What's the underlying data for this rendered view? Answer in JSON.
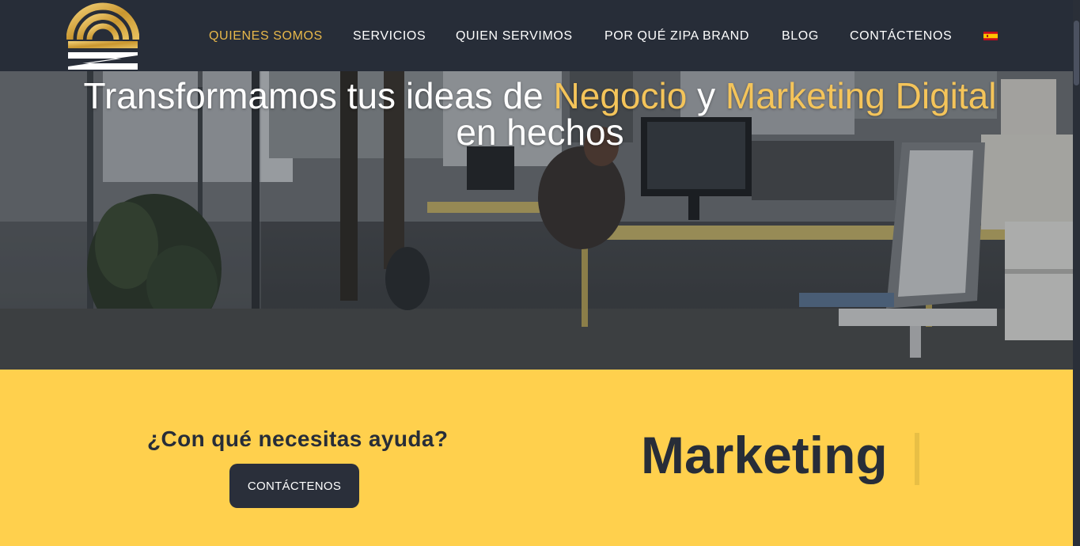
{
  "header": {
    "nav": [
      {
        "label": "QUIENES SOMOS",
        "active": true
      },
      {
        "label": "SERVICIOS",
        "active": false
      },
      {
        "label": "QUIEN SERVIMOS",
        "active": false
      },
      {
        "label": "POR QUÉ ZIPA BRAND",
        "active": false
      },
      {
        "label": "BLOG",
        "active": false
      },
      {
        "label": "CONTÁCTENOS",
        "active": false
      }
    ],
    "language_icon": "spain-flag-icon",
    "colors": {
      "background": "#272d38",
      "active": "#e8b84a",
      "text": "#ffffff"
    }
  },
  "hero": {
    "title_part1": "Transformamos tus ideas de ",
    "highlight1": "Negocio",
    "title_part2": " y ",
    "highlight2": "Marketing Digital",
    "title_part3": "en hechos",
    "highlight_color": "#f4c45a"
  },
  "cta": {
    "question": "¿Con qué necesitas ayuda?",
    "button_label": "CONTÁCTENOS",
    "rotating_word": "Marketing",
    "background": "#ffd04d"
  }
}
